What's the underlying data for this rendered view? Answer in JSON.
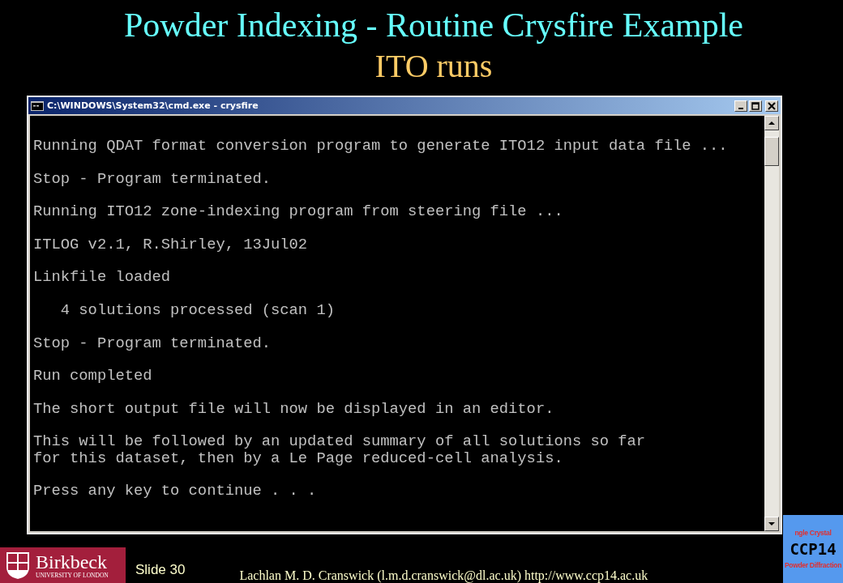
{
  "slide": {
    "title": "Powder Indexing - Routine Crysfire Example",
    "subtitle": "ITO runs"
  },
  "window": {
    "title": "C:\\WINDOWS\\System32\\cmd.exe - crysfire",
    "console_blocks": [
      {
        "lines": [
          "Running QDAT format conversion program to generate ITO12 input data file ..."
        ]
      },
      {
        "lines": [
          "Stop - Program terminated."
        ]
      },
      {
        "lines": [
          "Running ITO12 zone-indexing program from steering file ..."
        ]
      },
      {
        "lines": [
          "ITLOG v2.1, R.Shirley, 13Jul02"
        ],
        "extra_gap": true
      },
      {
        "lines": [
          "Linkfile loaded"
        ]
      },
      {
        "lines": [
          "   4 solutions processed (scan 1)"
        ]
      },
      {
        "lines": [
          "Stop - Program terminated."
        ]
      },
      {
        "lines": [
          "Run completed"
        ]
      },
      {
        "lines": [
          "The short output file will now be displayed in an editor."
        ]
      },
      {
        "lines": [
          "This will be followed by an updated summary of all solutions so far",
          "for this dataset, then by a Le Page reduced-cell analysis."
        ]
      },
      {
        "lines": [
          "Press any key to continue . . ."
        ]
      }
    ]
  },
  "footer": {
    "university_name": "Birkbeck",
    "university_sub": "UNIVERSITY OF LONDON",
    "slide_number": "Slide 30",
    "credit": "Lachlan M. D. Cranswick (l.m.d.cranswick@dl.ac.uk) http://www.ccp14.ac.uk",
    "badge": {
      "top": "ngle Crystal",
      "middle": "CCP14",
      "bottom": "Powder Diffraction"
    }
  }
}
